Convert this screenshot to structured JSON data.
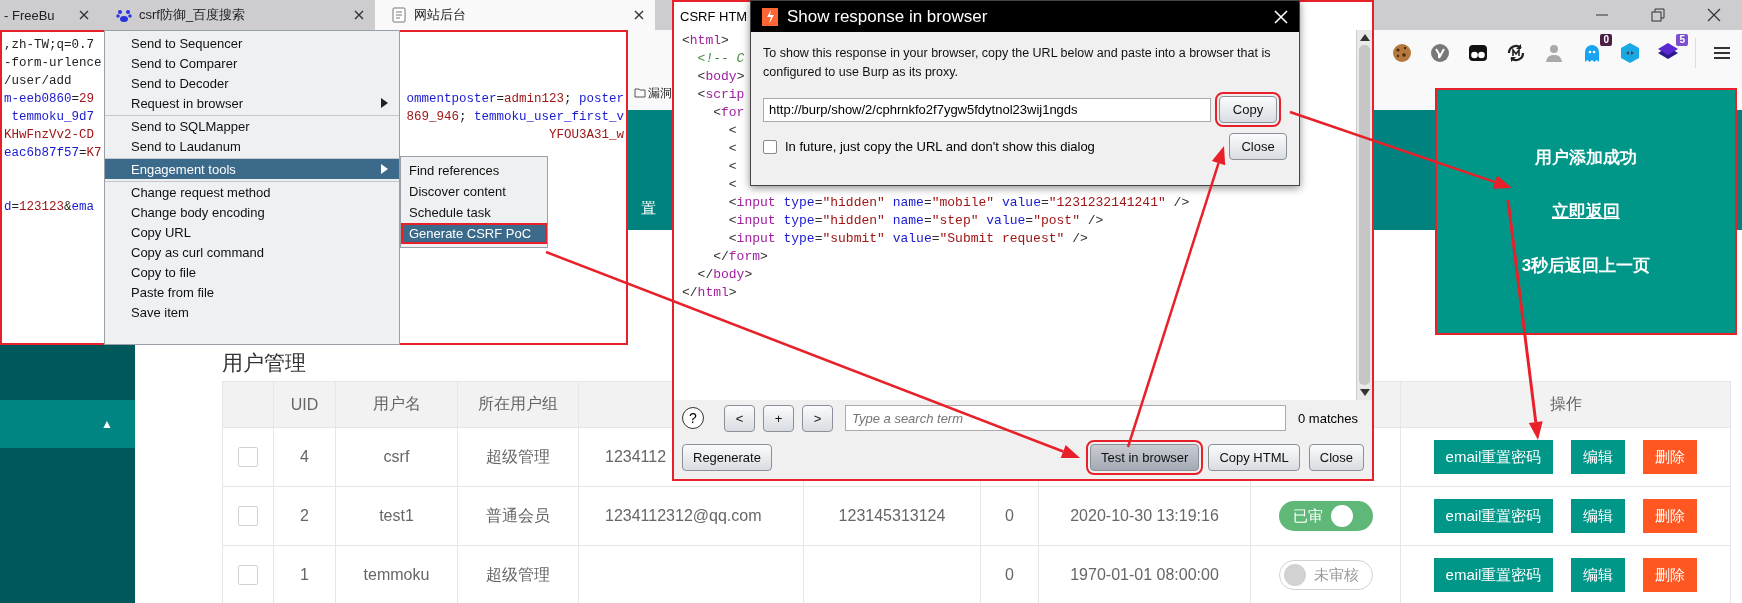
{
  "browser": {
    "tabs": [
      {
        "title": "- FreeBu",
        "selected": false
      },
      {
        "title": "csrf防御_百度搜索",
        "selected": false
      },
      {
        "title": "网站后台",
        "selected": true
      }
    ],
    "extensions": [
      {
        "kind": "cookie"
      },
      {
        "kind": "logo"
      },
      {
        "kind": "glasses"
      },
      {
        "kind": "cycle"
      },
      {
        "kind": "agent"
      },
      {
        "kind": "ghost",
        "badge": "0"
      },
      {
        "kind": "hexagon"
      },
      {
        "kind": "layers",
        "badge": "5"
      }
    ],
    "bookmark": "漏洞",
    "header_nav": "置"
  },
  "sidebar": {
    "items": [
      {
        "caret": "▲",
        "selected": true
      }
    ]
  },
  "page": {
    "heading": "用户管理",
    "table": {
      "columns": [
        "UID",
        "用户名",
        "所在用户组",
        "操作"
      ],
      "rows": [
        {
          "checked": false,
          "uid": "4",
          "username": "csrf",
          "group": "超级管理",
          "column_5": "1234112",
          "actions": [
            {
              "label": "email重置密码",
              "kind": "primary"
            },
            {
              "label": "编辑",
              "kind": "primary"
            },
            {
              "label": "删除",
              "kind": "danger"
            }
          ]
        },
        {
          "checked": false,
          "uid": "2",
          "username": "test1",
          "group": "普通会员",
          "column_5": "1234112312@qq.com",
          "column_6": "123145313124",
          "column_7": "0",
          "column_8": "2020-10-30 13:19:16",
          "column_9": {
            "label": "已审",
            "on": true
          },
          "actions": [
            {
              "label": "email重置密码",
              "kind": "primary"
            },
            {
              "label": "编辑",
              "kind": "primary"
            },
            {
              "label": "删除",
              "kind": "danger"
            }
          ]
        },
        {
          "checked": false,
          "uid": "1",
          "username": "temmoku",
          "group": "超级管理",
          "column_7": "0",
          "column_8": "1970-01-01 08:00:00",
          "column_9": {
            "label": "未审核",
            "on": false
          },
          "actions": [
            {
              "label": "email重置密码",
              "kind": "primary"
            },
            {
              "label": "编辑",
              "kind": "primary"
            },
            {
              "label": "删除",
              "kind": "danger"
            }
          ]
        }
      ]
    }
  },
  "request_editor": {
    "header_lines": [
      {
        "left": [
          {
            "text": ",zh-TW;q=0.7",
            "kind": "plain"
          }
        ]
      },
      {
        "left": [
          {
            "text": "-form-urlence",
            "kind": "plain"
          }
        ]
      },
      {
        "left": [
          {
            "text": "/user/add",
            "kind": "plain"
          }
        ]
      },
      {
        "left": [
          {
            "text": "m-eeb0860",
            "kind": "key"
          },
          {
            "text": "=",
            "kind": "plain"
          },
          {
            "text": "29",
            "kind": "value"
          }
        ],
        "right": [
          {
            "text": "ommentposter",
            "kind": "key"
          },
          {
            "text": "=",
            "kind": "plain"
          },
          {
            "text": "admin123",
            "kind": "value"
          },
          {
            "text": "; ",
            "kind": "plain"
          },
          {
            "text": "poster",
            "kind": "key"
          }
        ]
      },
      {
        "left": [
          {
            "text": " temmoku_9d7",
            "kind": "key"
          }
        ],
        "right": [
          {
            "text": "869_946",
            "kind": "value"
          },
          {
            "text": "; ",
            "kind": "plain"
          },
          {
            "text": "temmoku_user_first_v",
            "kind": "key"
          }
        ]
      },
      {
        "left": [
          {
            "text": "KHwFnzVv2-CD",
            "kind": "value"
          }
        ],
        "right": [
          {
            "text": "YFOU3A31_w",
            "kind": "value"
          }
        ]
      },
      {
        "left": [
          {
            "text": "eac6b87f57",
            "kind": "key"
          },
          {
            "text": "=",
            "kind": "plain"
          },
          {
            "text": "K7",
            "kind": "value"
          }
        ]
      }
    ],
    "body_lines": [
      {
        "left": [
          {
            "text": "d",
            "kind": "key"
          },
          {
            "text": "=",
            "kind": "plain"
          },
          {
            "text": "123123",
            "kind": "value"
          },
          {
            "text": "&",
            "kind": "plain"
          },
          {
            "text": "ema",
            "kind": "key"
          }
        ]
      }
    ]
  },
  "context_menu": {
    "items": [
      {
        "label": "Send to Sequencer",
        "has_submenu": false,
        "selected": false,
        "separator_before": false
      },
      {
        "label": "Send to Comparer",
        "has_submenu": false,
        "selected": false,
        "separator_before": false
      },
      {
        "label": "Send to Decoder",
        "has_submenu": false,
        "selected": false,
        "separator_before": false
      },
      {
        "label": "Request in browser",
        "has_submenu": true,
        "selected": false,
        "separator_before": false
      },
      {
        "label": "Send to SQLMapper",
        "has_submenu": false,
        "selected": false,
        "separator_before": true
      },
      {
        "label": "Send to Laudanum",
        "has_submenu": false,
        "selected": false,
        "separator_before": false
      },
      {
        "label": "Engagement tools",
        "has_submenu": true,
        "selected": true,
        "separator_before": true
      },
      {
        "label": "Change request method",
        "has_submenu": false,
        "selected": false,
        "separator_before": true
      },
      {
        "label": "Change body encoding",
        "has_submenu": false,
        "selected": false,
        "separator_before": false
      },
      {
        "label": "Copy URL",
        "has_submenu": false,
        "selected": false,
        "separator_before": false
      },
      {
        "label": "Copy as curl command",
        "has_submenu": false,
        "selected": false,
        "separator_before": false
      },
      {
        "label": "Copy to file",
        "has_submenu": false,
        "selected": false,
        "separator_before": false
      },
      {
        "label": "Paste from file",
        "has_submenu": false,
        "selected": false,
        "separator_before": false
      },
      {
        "label": "Save item",
        "has_submenu": false,
        "selected": false,
        "separator_before": false
      }
    ],
    "submenu": [
      {
        "label": "Find references",
        "selected": false,
        "annotated": false
      },
      {
        "label": "Discover content",
        "selected": false,
        "annotated": false
      },
      {
        "label": "Schedule task",
        "selected": false,
        "annotated": false
      },
      {
        "label": "Generate CSRF PoC",
        "selected": true,
        "annotated": true
      }
    ]
  },
  "csrf_window": {
    "title": "CSRF HTM",
    "code_lines": [
      {
        "tokens": [
          {
            "text": "<",
            "kind": "punct"
          },
          {
            "text": "html",
            "kind": "tag"
          },
          {
            "text": ">",
            "kind": "punct"
          }
        ]
      },
      {
        "tokens": [
          {
            "text": "  <!-- C",
            "kind": "comment"
          }
        ]
      },
      {
        "tokens": [
          {
            "text": "  <",
            "kind": "punct"
          },
          {
            "text": "body",
            "kind": "tag"
          },
          {
            "text": ">",
            "kind": "punct"
          }
        ]
      },
      {
        "tokens": [
          {
            "text": "  <",
            "kind": "punct"
          },
          {
            "text": "scrip",
            "kind": "tag"
          }
        ]
      },
      {
        "tokens": [
          {
            "text": "    <",
            "kind": "punct"
          },
          {
            "text": "for",
            "kind": "tag"
          }
        ]
      },
      {
        "tokens": [
          {
            "text": "      <",
            "kind": "punct"
          }
        ]
      },
      {
        "tokens": [
          {
            "text": "      <",
            "kind": "punct"
          }
        ]
      },
      {
        "tokens": [
          {
            "text": "      <",
            "kind": "punct"
          }
        ]
      },
      {
        "tokens": [
          {
            "text": "      <",
            "kind": "punct"
          }
        ]
      },
      {
        "tokens": [
          {
            "text": "      <",
            "kind": "punct"
          },
          {
            "text": "input",
            "kind": "tag"
          },
          {
            "text": " type",
            "kind": "attr"
          },
          {
            "text": "=",
            "kind": "punct"
          },
          {
            "text": "\"hidden\"",
            "kind": "value"
          },
          {
            "text": " name",
            "kind": "attr"
          },
          {
            "text": "=",
            "kind": "punct"
          },
          {
            "text": "\"mobile\"",
            "kind": "value"
          },
          {
            "text": " value",
            "kind": "attr"
          },
          {
            "text": "=",
            "kind": "punct"
          },
          {
            "text": "\"1231232141241\"",
            "kind": "value"
          },
          {
            "text": " />",
            "kind": "punct"
          }
        ]
      },
      {
        "tokens": [
          {
            "text": "      <",
            "kind": "punct"
          },
          {
            "text": "input",
            "kind": "tag"
          },
          {
            "text": " type",
            "kind": "attr"
          },
          {
            "text": "=",
            "kind": "punct"
          },
          {
            "text": "\"hidden\"",
            "kind": "value"
          },
          {
            "text": " name",
            "kind": "attr"
          },
          {
            "text": "=",
            "kind": "punct"
          },
          {
            "text": "\"step\"",
            "kind": "value"
          },
          {
            "text": " value",
            "kind": "attr"
          },
          {
            "text": "=",
            "kind": "punct"
          },
          {
            "text": "\"post\"",
            "kind": "value"
          },
          {
            "text": " />",
            "kind": "punct"
          }
        ]
      },
      {
        "tokens": [
          {
            "text": "      <",
            "kind": "punct"
          },
          {
            "text": "input",
            "kind": "tag"
          },
          {
            "text": " type",
            "kind": "attr"
          },
          {
            "text": "=",
            "kind": "punct"
          },
          {
            "text": "\"submit\"",
            "kind": "value"
          },
          {
            "text": " value",
            "kind": "attr"
          },
          {
            "text": "=",
            "kind": "punct"
          },
          {
            "text": "\"Submit request\"",
            "kind": "value"
          },
          {
            "text": " />",
            "kind": "punct"
          }
        ]
      },
      {
        "tokens": [
          {
            "text": "    </",
            "kind": "punct"
          },
          {
            "text": "form",
            "kind": "tag"
          },
          {
            "text": ">",
            "kind": "punct"
          }
        ]
      },
      {
        "tokens": [
          {
            "text": "  </",
            "kind": "punct"
          },
          {
            "text": "body",
            "kind": "tag"
          },
          {
            "text": ">",
            "kind": "punct"
          }
        ]
      },
      {
        "tokens": [
          {
            "text": "</",
            "kind": "punct"
          },
          {
            "text": "html",
            "kind": "tag"
          },
          {
            "text": ">",
            "kind": "punct"
          }
        ]
      }
    ],
    "help": "?",
    "nav_buttons": [
      "<",
      "+",
      ">"
    ],
    "search": {
      "placeholder": "Type a search term"
    },
    "matches": "0 matches",
    "buttons": [
      {
        "label": "Regenerate",
        "focused": false,
        "annotated": false
      },
      {
        "label": "Test in browser",
        "focused": true,
        "annotated": true
      },
      {
        "label": "Copy HTML",
        "focused": false,
        "annotated": false
      },
      {
        "label": "Close",
        "focused": false,
        "annotated": false
      }
    ]
  },
  "dialog": {
    "title": "Show response in browser",
    "message": "To show this response in your browser, copy the URL below and paste into a browser that is configured to use Burp as its proxy.",
    "url": "http://burp/show/2/cphrnkfo2f7ygw5fdytnol23wij1ngds",
    "buttons": [
      {
        "label": "Copy",
        "annotated": true
      },
      {
        "label": "Close",
        "annotated": false
      }
    ],
    "checkbox": {
      "label": "In future, just copy the URL and don't show this dialog",
      "checked": false
    }
  },
  "success_panel": {
    "message": "用户添加成功",
    "link": "立即返回",
    "countdown": "3秒后返回上一页"
  }
}
